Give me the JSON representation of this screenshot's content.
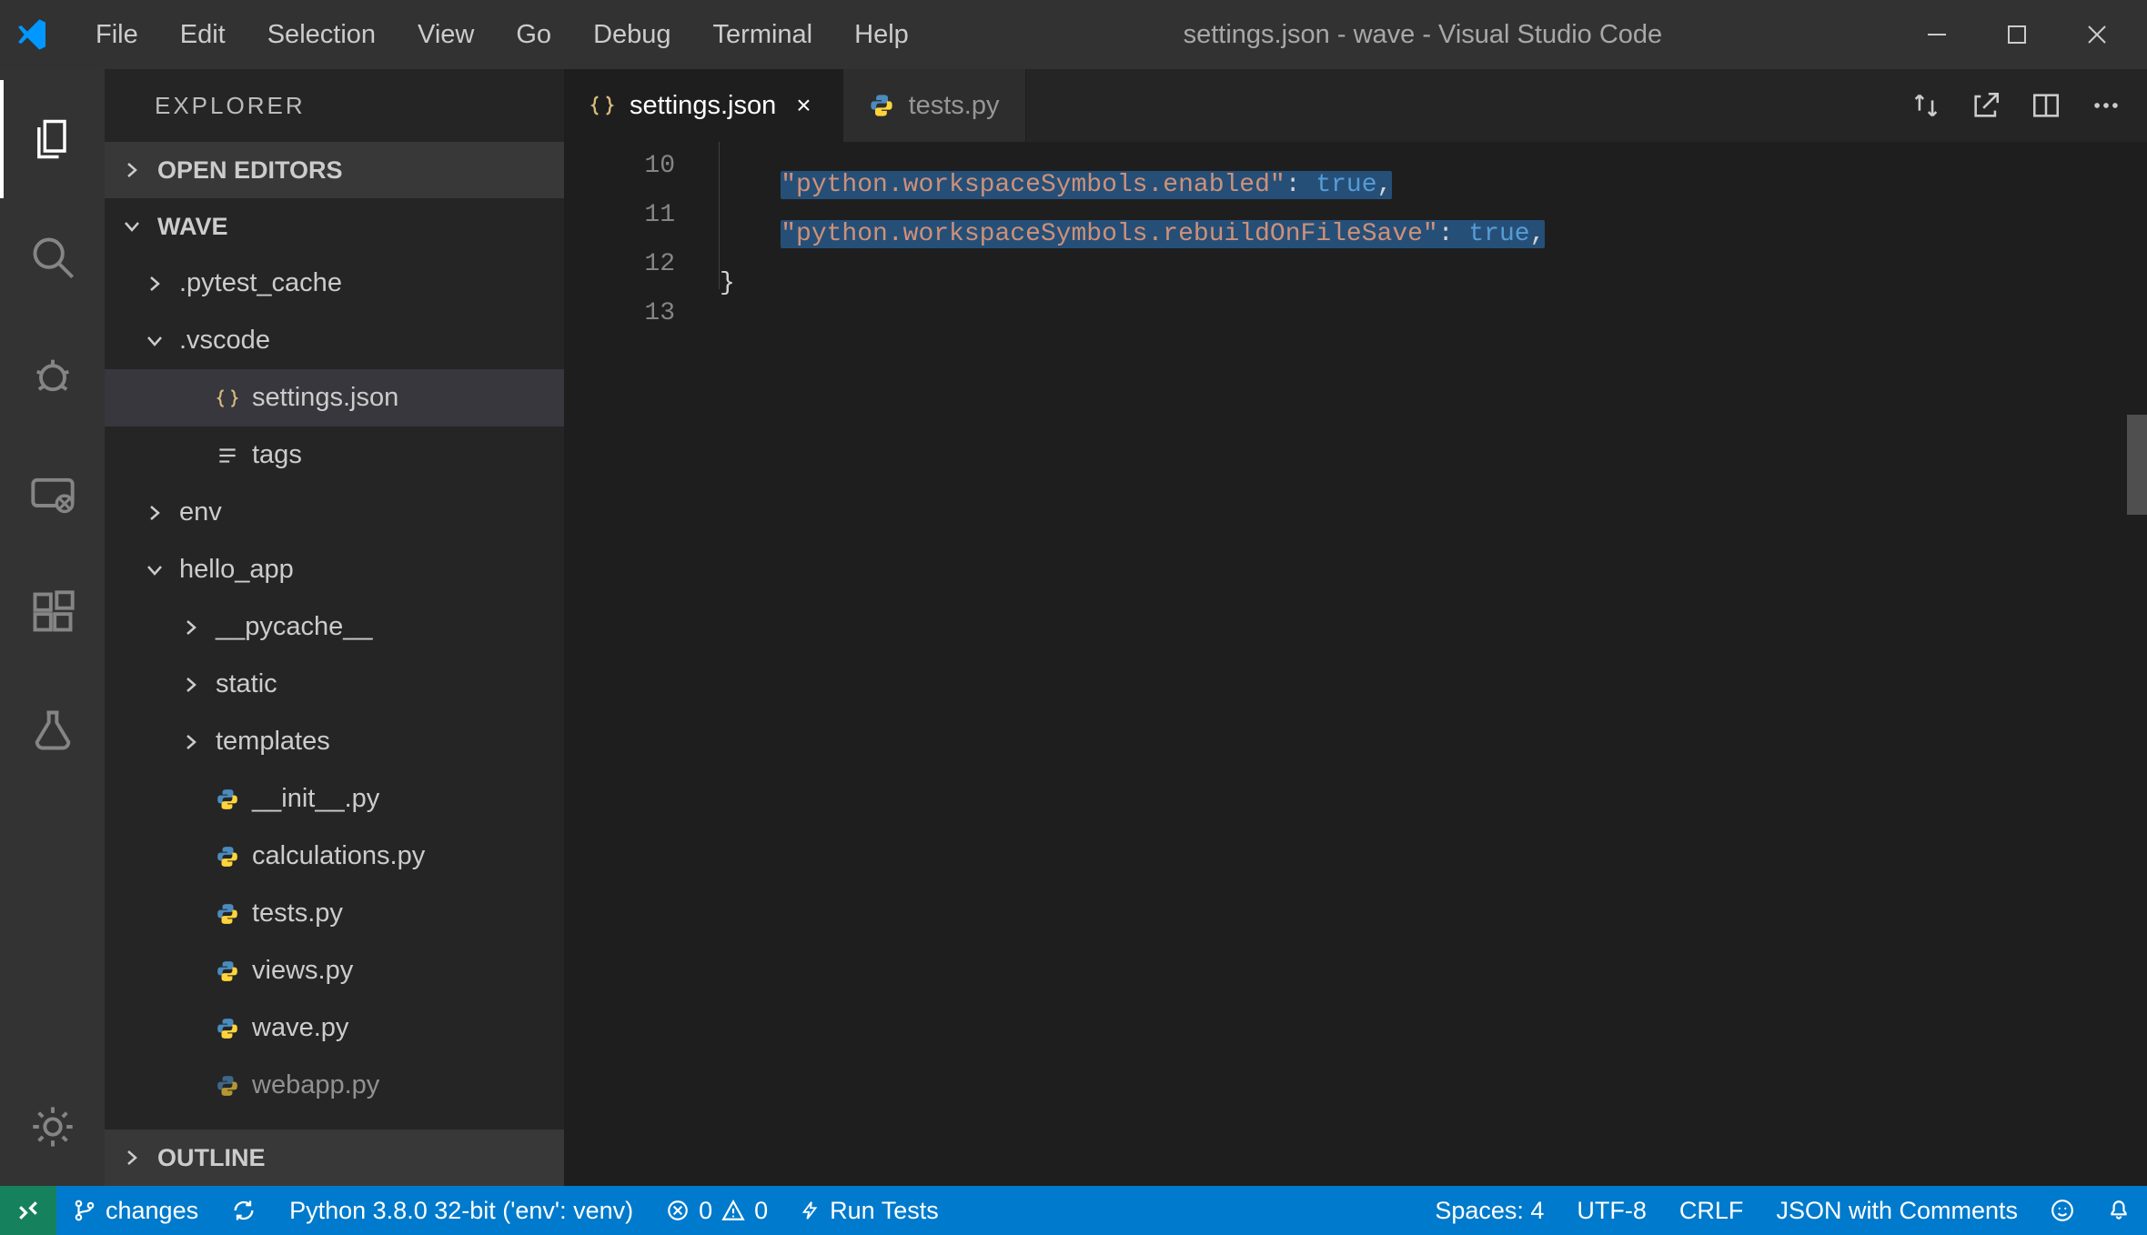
{
  "title": "settings.json - wave - Visual Studio Code",
  "menu": [
    "File",
    "Edit",
    "Selection",
    "View",
    "Go",
    "Debug",
    "Terminal",
    "Help"
  ],
  "sidebar": {
    "title": "EXPLORER",
    "sections": {
      "open_editors": "OPEN EDITORS",
      "workspace": "WAVE",
      "outline": "OUTLINE"
    },
    "tree": [
      {
        "indent": 0,
        "type": "folder",
        "state": "collapsed",
        "label": ".pytest_cache"
      },
      {
        "indent": 0,
        "type": "folder",
        "state": "expanded",
        "label": ".vscode"
      },
      {
        "indent": 1,
        "type": "file",
        "icon": "json",
        "label": "settings.json",
        "active": true
      },
      {
        "indent": 1,
        "type": "file",
        "icon": "lines",
        "label": "tags"
      },
      {
        "indent": 0,
        "type": "folder",
        "state": "collapsed",
        "label": "env"
      },
      {
        "indent": 0,
        "type": "folder",
        "state": "expanded",
        "label": "hello_app"
      },
      {
        "indent": 1,
        "type": "folder",
        "state": "collapsed",
        "label": "__pycache__"
      },
      {
        "indent": 1,
        "type": "folder",
        "state": "collapsed",
        "label": "static"
      },
      {
        "indent": 1,
        "type": "folder",
        "state": "collapsed",
        "label": "templates"
      },
      {
        "indent": 1,
        "type": "file",
        "icon": "py",
        "label": "__init__.py"
      },
      {
        "indent": 1,
        "type": "file",
        "icon": "py",
        "label": "calculations.py"
      },
      {
        "indent": 1,
        "type": "file",
        "icon": "py",
        "label": "tests.py"
      },
      {
        "indent": 1,
        "type": "file",
        "icon": "py",
        "label": "views.py"
      },
      {
        "indent": 1,
        "type": "file",
        "icon": "py",
        "label": "wave.py"
      },
      {
        "indent": 1,
        "type": "file",
        "icon": "py",
        "label": "webapp.py",
        "cut": true
      }
    ]
  },
  "tabs": [
    {
      "icon": "json",
      "label": "settings.json",
      "active": true,
      "closable": true
    },
    {
      "icon": "py",
      "label": "tests.py",
      "active": false,
      "closable": false
    }
  ],
  "line_numbers": [
    "10",
    "11",
    "12",
    "13"
  ],
  "code": {
    "l10_key": "\"python.workspaceSymbols.enabled\"",
    "l10_val": "true",
    "l11_key": "\"python.workspaceSymbols.rebuildOnFileSave\"",
    "l11_val": "true",
    "l12": "}"
  },
  "status": {
    "branch": "changes",
    "python": "Python 3.8.0 32-bit ('env': venv)",
    "errors": "0",
    "warnings": "0",
    "run_tests": "Run Tests",
    "spaces": "Spaces: 4",
    "encoding": "UTF-8",
    "eol": "CRLF",
    "lang": "JSON with Comments"
  }
}
